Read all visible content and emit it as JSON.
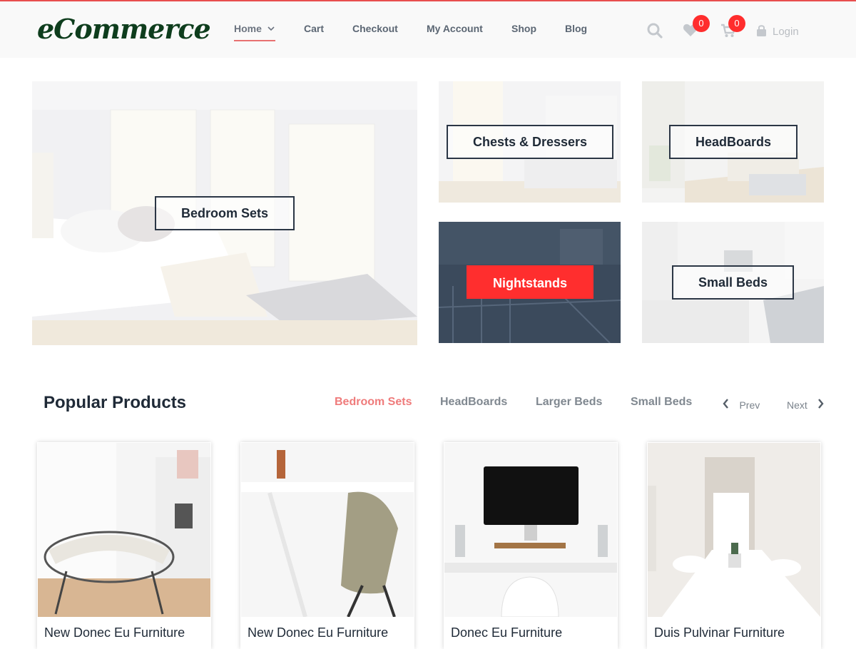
{
  "header": {
    "logo": "eCommerce",
    "nav": [
      {
        "label": "Home",
        "active": true,
        "has_dropdown": true
      },
      {
        "label": "Cart",
        "active": false
      },
      {
        "label": "Checkout",
        "active": false
      },
      {
        "label": "My Account",
        "active": false
      },
      {
        "label": "Shop",
        "active": false
      },
      {
        "label": "Blog",
        "active": false
      }
    ],
    "icons": {
      "search": "search-icon",
      "wishlist": "heart-icon",
      "cart": "cart-icon",
      "lock": "lock-icon",
      "chevron": "chevron-down-icon"
    },
    "wishlist_count": "0",
    "cart_count": "0",
    "login_label": "Login",
    "accent_color": "#e84e4e"
  },
  "categories": [
    {
      "label": "Bedroom Sets"
    },
    {
      "label": "Chests & Dressers"
    },
    {
      "label": "HeadBoards"
    },
    {
      "label": "Nightstands",
      "highlighted": true
    },
    {
      "label": "Small Beds"
    }
  ],
  "popular": {
    "title": "Popular Products",
    "tabs": [
      {
        "label": "Bedroom Sets",
        "active": true
      },
      {
        "label": "HeadBoards",
        "active": false
      },
      {
        "label": "Larger Beds",
        "active": false
      },
      {
        "label": "Small Beds",
        "active": false
      }
    ],
    "prev_label": "Prev",
    "next_label": "Next",
    "products": [
      {
        "name": "New Donec Eu Furniture"
      },
      {
        "name": "New Donec Eu Furniture"
      },
      {
        "name": "Donec Eu Furniture"
      },
      {
        "name": "Duis Pulvinar Furniture"
      }
    ]
  }
}
